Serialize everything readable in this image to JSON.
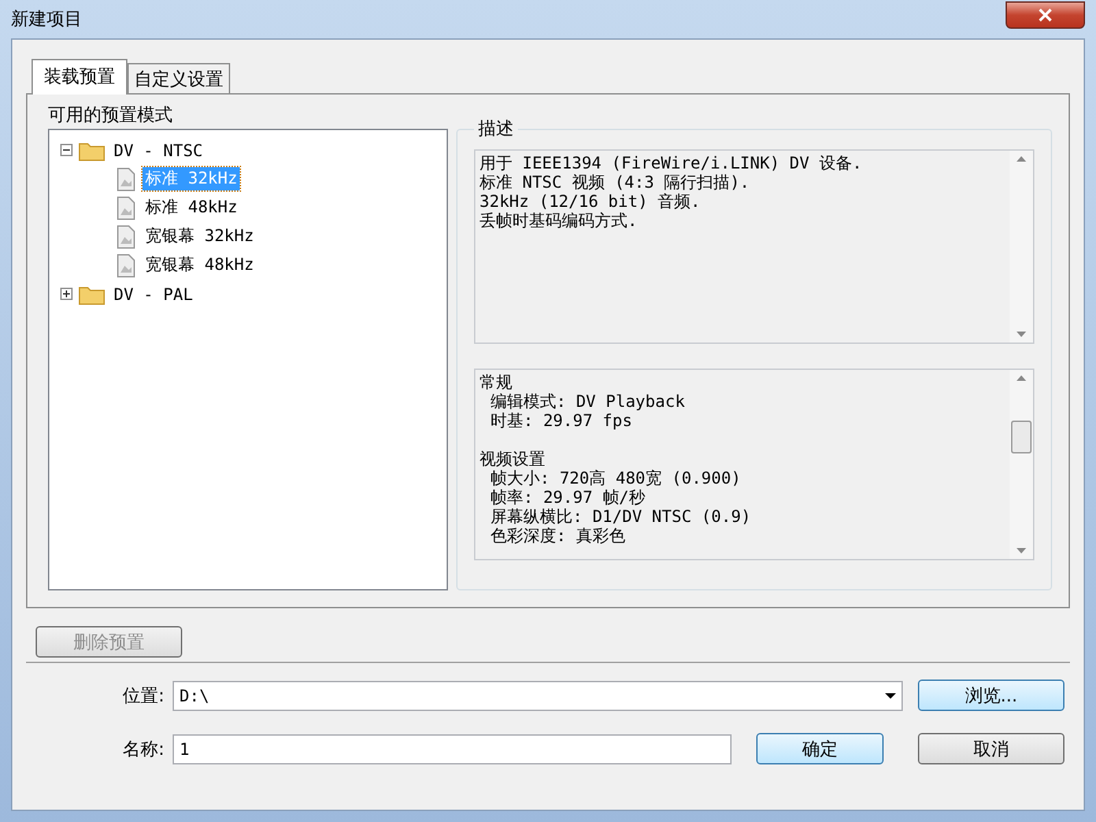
{
  "window": {
    "title": "新建项目"
  },
  "tabs": [
    {
      "label": "装载预置",
      "selected": true
    },
    {
      "label": "自定义设置",
      "selected": false
    }
  ],
  "presets": {
    "label": "可用的预置模式",
    "tree": [
      {
        "label": "DV - NTSC",
        "expanded": true,
        "children": [
          {
            "label": "标准 32kHz",
            "selected": true
          },
          {
            "label": "标准 48kHz",
            "selected": false
          },
          {
            "label": "宽银幕 32kHz",
            "selected": false
          },
          {
            "label": "宽银幕 48kHz",
            "selected": false
          }
        ]
      },
      {
        "label": "DV - PAL",
        "expanded": false
      }
    ]
  },
  "description": {
    "title": "描述",
    "lines": [
      "用于 IEEE1394 (FireWire/i.LINK) DV 设备.",
      "标准 NTSC 视频 (4:3 隔行扫描).",
      "32kHz (12/16 bit) 音频.",
      "丢帧时基码编码方式."
    ]
  },
  "details": [
    {
      "heading": "常规",
      "lines": [
        "编辑模式: DV Playback",
        "时基: 29.97 fps"
      ]
    },
    {
      "heading": "视频设置",
      "lines": [
        "帧大小: 720高 480宽 (0.900)",
        "帧率: 29.97 帧/秒",
        "屏幕纵横比: D1/DV NTSC (0.9)",
        "色彩深度: 真彩色"
      ]
    }
  ],
  "delete_button": {
    "label": "删除预置",
    "disabled": true
  },
  "location": {
    "label": "位置:",
    "value": "D:\\"
  },
  "browse_button": {
    "label": "浏览..."
  },
  "name": {
    "label": "名称:",
    "value": "1"
  },
  "ok_button": {
    "label": "确定"
  },
  "cancel_button": {
    "label": "取消"
  }
}
